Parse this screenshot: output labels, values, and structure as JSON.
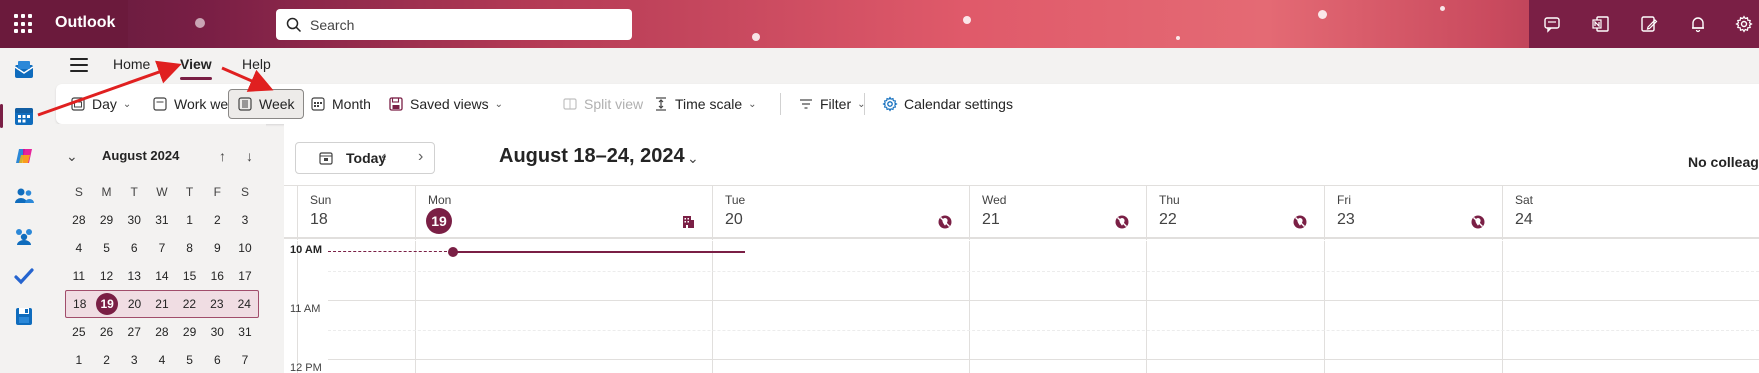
{
  "header": {
    "app_name": "Outlook",
    "search_placeholder": "Search",
    "icons": [
      "waffle-icon",
      "search-icon",
      "chat-icon",
      "onenote-icon",
      "edit-note-icon",
      "bell-icon",
      "gear-icon"
    ]
  },
  "rail": {
    "items": [
      {
        "name": "mail",
        "icon": "mail-icon"
      },
      {
        "name": "calendar",
        "icon": "calendar-icon",
        "active": true
      },
      {
        "name": "copilot",
        "icon": "copilot-icon"
      },
      {
        "name": "people",
        "icon": "people-icon"
      },
      {
        "name": "groups",
        "icon": "groups-icon"
      },
      {
        "name": "todo",
        "icon": "todo-check-icon"
      },
      {
        "name": "files",
        "icon": "files-icon"
      }
    ]
  },
  "menu": {
    "tabs": [
      "Home",
      "View",
      "Help"
    ],
    "active_tab": "View"
  },
  "ribbon": {
    "day": "Day",
    "work_week": "Work week",
    "week": "Week",
    "month": "Month",
    "saved_views": "Saved views",
    "split_view": "Split view",
    "time_scale": "Time scale",
    "filter": "Filter",
    "calendar_settings": "Calendar settings"
  },
  "mini_calendar": {
    "title": "August 2024",
    "dow": [
      "S",
      "M",
      "T",
      "W",
      "T",
      "F",
      "S"
    ],
    "weeks": [
      [
        "28",
        "29",
        "30",
        "31",
        "1",
        "2",
        "3"
      ],
      [
        "4",
        "5",
        "6",
        "7",
        "8",
        "9",
        "10"
      ],
      [
        "11",
        "12",
        "13",
        "14",
        "15",
        "16",
        "17"
      ],
      [
        "18",
        "19",
        "20",
        "21",
        "22",
        "23",
        "24"
      ],
      [
        "25",
        "26",
        "27",
        "28",
        "29",
        "30",
        "31"
      ],
      [
        "1",
        "2",
        "3",
        "4",
        "5",
        "6",
        "7"
      ]
    ],
    "selected_week_index": 3,
    "today": "19"
  },
  "calendar": {
    "today_label": "Today",
    "range_title": "August 18–24, 2024",
    "colleagues_label": "No colleagu",
    "days": [
      {
        "name": "Sun",
        "num": "18"
      },
      {
        "name": "Mon",
        "num": "19",
        "today": true
      },
      {
        "name": "Tue",
        "num": "20"
      },
      {
        "name": "Wed",
        "num": "21"
      },
      {
        "name": "Thu",
        "num": "22"
      },
      {
        "name": "Fri",
        "num": "23"
      },
      {
        "name": "Sat",
        "num": "24"
      }
    ],
    "time_labels": [
      "10 AM",
      "11 AM",
      "12 PM"
    ]
  },
  "colors": {
    "accent": "#7a1f45",
    "selected_week_bg": "#f0dde3",
    "annotation_arrow": "#e02020"
  }
}
